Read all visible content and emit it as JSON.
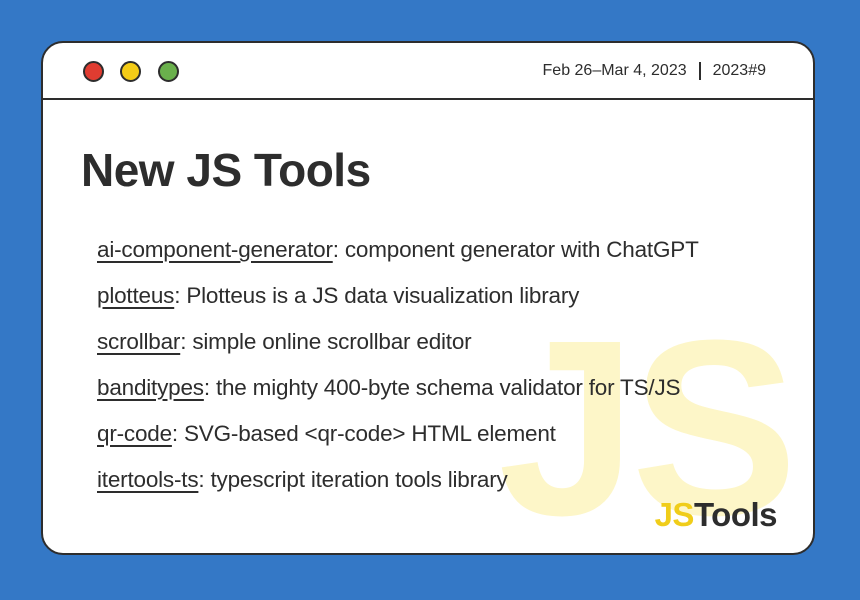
{
  "header": {
    "date_range": "Feb 26–Mar 4, 2023",
    "issue": "2023#9"
  },
  "title": "New JS Tools",
  "tools": [
    {
      "name": "ai-component-generator",
      "description": ": component generator with ChatGPT"
    },
    {
      "name": "plotteus",
      "description": ": Plotteus is a JS data visualization library"
    },
    {
      "name": "scrollbar",
      "description": ": simple online scrollbar editor"
    },
    {
      "name": "banditypes",
      "description": ": the mighty 400-byte schema validator for TS/JS"
    },
    {
      "name": "qr-code",
      "description": ": SVG-based <qr-code> HTML element"
    },
    {
      "name": "itertools-ts",
      "description": ": typescript iteration tools library"
    }
  ],
  "watermark": "JS",
  "brand": {
    "js": "JS",
    "tools": "Tools"
  },
  "colors": {
    "background": "#3478c6",
    "window": "#ffffff",
    "text": "#2d2d2d",
    "accent_yellow": "#f0cd1a",
    "watermark": "#fdf6c8",
    "dot_red": "#e03c31",
    "dot_yellow": "#f4cc17",
    "dot_green": "#6ab04c"
  }
}
